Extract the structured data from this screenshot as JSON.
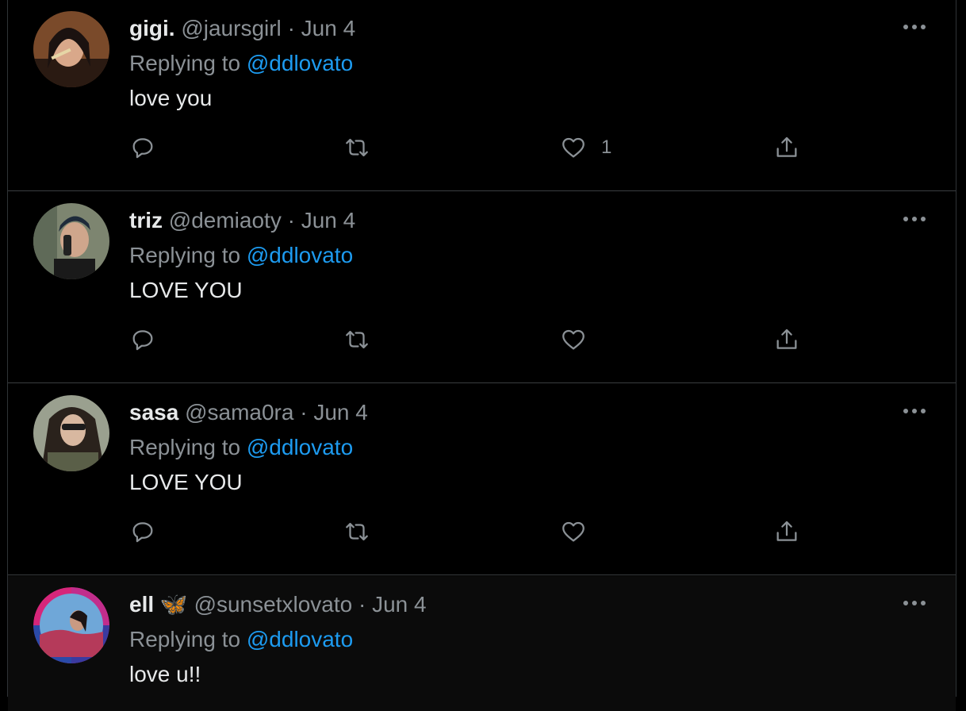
{
  "tweets": [
    {
      "name": "gigi.",
      "handle": "@jaursgirl",
      "separator": "·",
      "date": "Jun 4",
      "replying_prefix": "Replying to",
      "replying_to": "@ddlovato",
      "text": "love you",
      "like_count": "1"
    },
    {
      "name": "triz",
      "handle": "@demiaoty",
      "separator": "·",
      "date": "Jun 4",
      "replying_prefix": "Replying to",
      "replying_to": "@ddlovato",
      "text": "LOVE YOU",
      "like_count": ""
    },
    {
      "name": "sasa",
      "handle": "@sama0ra",
      "separator": "·",
      "date": "Jun 4",
      "replying_prefix": "Replying to",
      "replying_to": "@ddlovato",
      "text": "LOVE YOU",
      "like_count": ""
    },
    {
      "name": "ell 🦋",
      "handle": "@sunsetxlovato",
      "separator": "·",
      "date": "Jun 4",
      "replying_prefix": "Replying to",
      "replying_to": "@ddlovato",
      "text": "love u!!",
      "like_count": ""
    }
  ],
  "colors": {
    "background": "#000000",
    "accent": "#1d9bf0",
    "secondary_text": "#8b9196",
    "primary_text": "#e7e9ea"
  },
  "icons": {
    "reply": "reply-icon",
    "retweet": "retweet-icon",
    "like": "heart-icon",
    "share": "share-icon",
    "more": "more-icon"
  }
}
